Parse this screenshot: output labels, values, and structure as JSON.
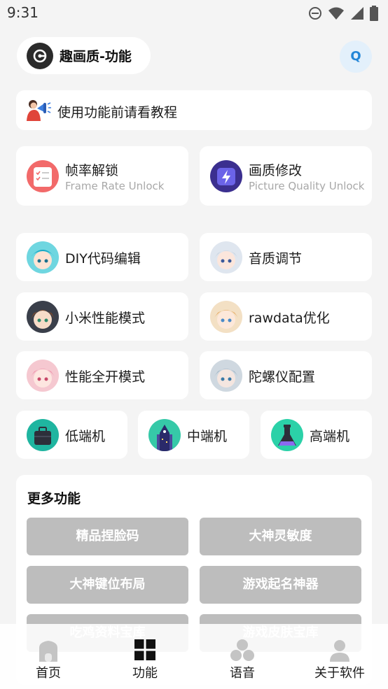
{
  "status_bar": {
    "time": "9:31"
  },
  "header": {
    "title": "趣画质-功能",
    "avatar_letter": "Q"
  },
  "tutorial": {
    "text": "使用功能前请看教程"
  },
  "feature_cards": {
    "frame_rate": {
      "title": "帧率解锁",
      "subtitle": "Frame Rate Unlock"
    },
    "picture_quality": {
      "title": "画质修改",
      "subtitle": "Picture Quality Unlock"
    }
  },
  "tools": [
    {
      "label": "DIY代码编辑"
    },
    {
      "label": "音质调节"
    },
    {
      "label": "小米性能模式"
    },
    {
      "label": "rawdata优化"
    },
    {
      "label": "性能全开模式"
    },
    {
      "label": "陀螺仪配置"
    }
  ],
  "device_tiers": [
    {
      "label": "低端机"
    },
    {
      "label": "中端机"
    },
    {
      "label": "高端机"
    }
  ],
  "more": {
    "title": "更多功能",
    "buttons": [
      {
        "label": "精品捏脸码"
      },
      {
        "label": "大神灵敏度"
      },
      {
        "label": "大神键位布局"
      },
      {
        "label": "游戏起名神器"
      },
      {
        "label": "吃鸡资料宝库"
      },
      {
        "label": "游戏皮肤宝库"
      }
    ]
  },
  "bottom_nav": {
    "items": [
      {
        "label": "首页",
        "icon": "home-icon"
      },
      {
        "label": "功能",
        "icon": "grid-icon"
      },
      {
        "label": "语音",
        "icon": "voice-icon"
      },
      {
        "label": "关于软件",
        "icon": "user-icon"
      }
    ]
  },
  "colors": {
    "background": "#f4f4f4",
    "card": "#ffffff",
    "gray_button": "#bdbdbd",
    "avatar_bg": "#e3f0fb",
    "avatar_text": "#2386d7"
  }
}
